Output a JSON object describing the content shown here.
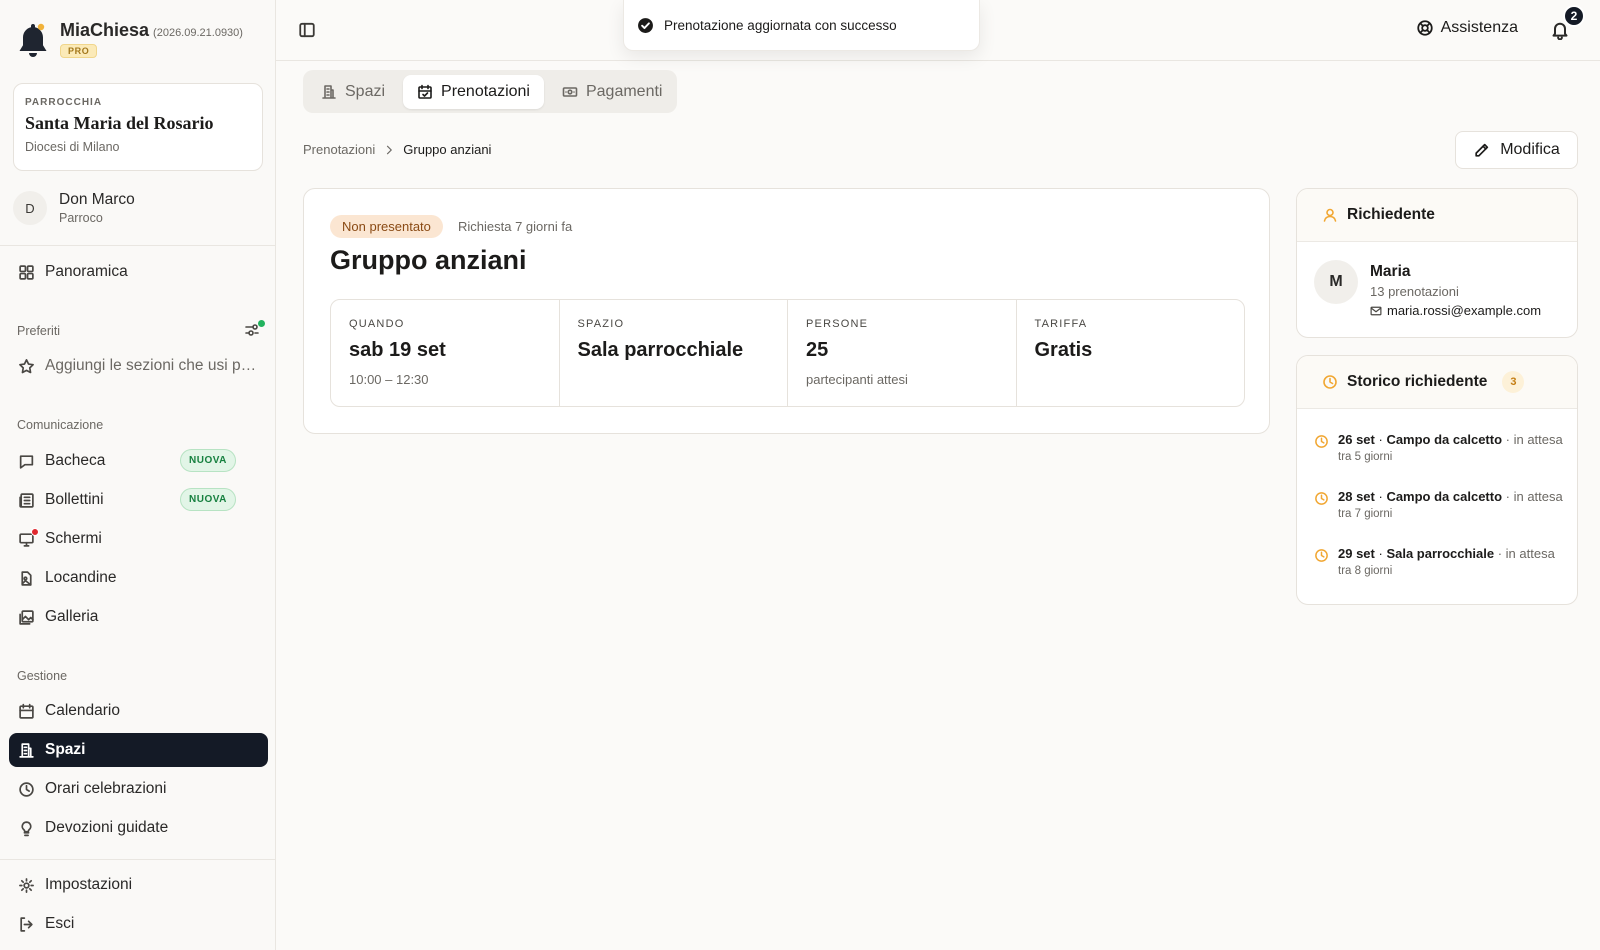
{
  "app": {
    "name": "MiaChiesa",
    "version": "(2026.09.21.0930)",
    "plan": "PRO"
  },
  "parish": {
    "kicker": "PARROCCHIA",
    "name": "Santa Maria del Rosario",
    "diocese": "Diocesi di Milano"
  },
  "user": {
    "initial": "D",
    "name": "Don Marco",
    "role": "Parroco"
  },
  "nav": {
    "overview": "Panoramica",
    "favorites_title": "Preferiti",
    "favorites_hint": "Aggiungi le sezioni che usi più spesso",
    "communication_title": "Comunicazione",
    "bacheca": "Bacheca",
    "bollettini": "Bollettini",
    "new_badge": "NUOVA",
    "schermi": "Schermi",
    "locandine": "Locandine",
    "galleria": "Galleria",
    "management_title": "Gestione",
    "calendario": "Calendario",
    "spazi": "Spazi",
    "orari": "Orari celebrazioni",
    "devozioni": "Devozioni guidate",
    "impostazioni": "Impostazioni",
    "esci": "Esci"
  },
  "topbar": {
    "help": "Assistenza",
    "notifications": "2"
  },
  "toast": {
    "message": "Prenotazione aggiornata con successo"
  },
  "tabs": [
    {
      "label": "Spazi",
      "icon": "building-icon"
    },
    {
      "label": "Prenotazioni",
      "icon": "calendar-check-icon"
    },
    {
      "label": "Pagamenti",
      "icon": "banknote-icon"
    }
  ],
  "breadcrumb": {
    "parent": "Prenotazioni",
    "current": "Gruppo anziani"
  },
  "edit_label": "Modifica",
  "booking": {
    "status": "Non presentato",
    "requested": "Richiesta 7 giorni fa",
    "title": "Gruppo anziani",
    "stats": [
      {
        "key": "QUANDO",
        "value": "sab 19 set",
        "sub": "10:00 – 12:30"
      },
      {
        "key": "SPAZIO",
        "value": "Sala parrocchiale",
        "sub": ""
      },
      {
        "key": "PERSONE",
        "value": "25",
        "sub": "partecipanti attesi"
      },
      {
        "key": "TARIFFA",
        "value": "Gratis",
        "sub": ""
      }
    ]
  },
  "requester": {
    "title": "Richiedente",
    "initial": "M",
    "name": "Maria",
    "bookings": "13 prenotazioni",
    "email": "maria.rossi@example.com"
  },
  "history": {
    "title": "Storico richiedente",
    "count": "3",
    "items": [
      {
        "date": "26 set",
        "space": "Campo da calcetto",
        "status": "in attesa",
        "when": "tra 5 giorni"
      },
      {
        "date": "28 set",
        "space": "Campo da calcetto",
        "status": "in attesa",
        "when": "tra 7 giorni"
      },
      {
        "date": "29 set",
        "space": "Sala parrocchiale",
        "status": "in attesa",
        "when": "tra 8 giorni"
      }
    ]
  }
}
